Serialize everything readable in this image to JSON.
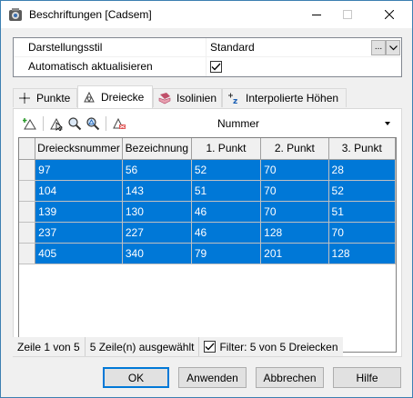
{
  "window": {
    "title": "Beschriftungen [Cadsem]"
  },
  "properties": [
    {
      "label": "Darstellungsstil",
      "value": "Standard"
    },
    {
      "label": "Automatisch aktualisieren",
      "value": ""
    }
  ],
  "properties_ellipsis": "...",
  "autoupdate_checked": true,
  "tabs": [
    {
      "label": "Punkte",
      "icon": "crosshair-icon"
    },
    {
      "label": "Dreiecke",
      "icon": "triangles-icon",
      "active": true
    },
    {
      "label": "Isolinien",
      "icon": "contours-icon"
    },
    {
      "label": "Interpolierte Höhen",
      "icon": "height-z-icon"
    }
  ],
  "toolbar": {
    "icons": [
      "add-triangle-icon",
      "select-icon",
      "zoom-to-icon",
      "zoom-selection-icon",
      "delete-label-icon"
    ],
    "combo_value": "Nummer"
  },
  "grid": {
    "columns": [
      "Dreiecksnummer",
      "Bezeichnung",
      "1. Punkt",
      "2. Punkt",
      "3. Punkt"
    ],
    "rows": [
      [
        "97",
        "56",
        "52",
        "70",
        "28"
      ],
      [
        "104",
        "143",
        "51",
        "70",
        "52"
      ],
      [
        "139",
        "130",
        "46",
        "70",
        "51"
      ],
      [
        "237",
        "227",
        "46",
        "128",
        "70"
      ],
      [
        "405",
        "340",
        "79",
        "201",
        "128"
      ]
    ],
    "selection_color": "#0078d7"
  },
  "status": {
    "position": "Zeile 1 von 5",
    "selected": "5 Zeile(n) ausgewählt",
    "filter": "Filter: 5 von 5 Dreiecken",
    "filter_checked": true
  },
  "buttons": {
    "ok": "OK",
    "apply": "Anwenden",
    "cancel": "Abbrechen",
    "help": "Hilfe"
  }
}
